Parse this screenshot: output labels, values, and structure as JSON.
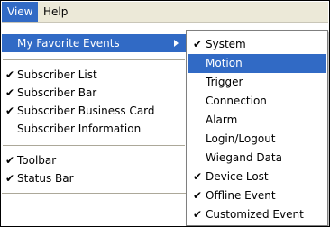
{
  "menubar": {
    "items": [
      {
        "label": "View",
        "active": true
      },
      {
        "label": "Help",
        "active": false
      }
    ]
  },
  "view_menu": {
    "items": [
      {
        "label": "My Favorite Events",
        "checked": false,
        "submenu": true,
        "highlighted": true
      },
      {
        "label": "Subscriber List",
        "checked": true
      },
      {
        "label": "Subscriber Bar",
        "checked": true
      },
      {
        "label": "Subscriber Business Card",
        "checked": true
      },
      {
        "label": "Subscriber Information",
        "checked": false
      },
      {
        "label": "Toolbar",
        "checked": true
      },
      {
        "label": "Status Bar",
        "checked": true
      }
    ]
  },
  "events_submenu": {
    "items": [
      {
        "label": "System",
        "checked": true
      },
      {
        "label": "Motion",
        "checked": false,
        "highlighted": true
      },
      {
        "label": "Trigger",
        "checked": false
      },
      {
        "label": "Connection",
        "checked": false
      },
      {
        "label": "Alarm",
        "checked": false
      },
      {
        "label": "Login/Logout",
        "checked": false
      },
      {
        "label": "Wiegand Data",
        "checked": false
      },
      {
        "label": "Device Lost",
        "checked": true
      },
      {
        "label": "Offline Event",
        "checked": true
      },
      {
        "label": "Customized Event",
        "checked": true
      }
    ]
  },
  "glyphs": {
    "check": "✔"
  },
  "colors": {
    "highlight": "#316ac5",
    "menubar_bg": "#ece9d8"
  }
}
